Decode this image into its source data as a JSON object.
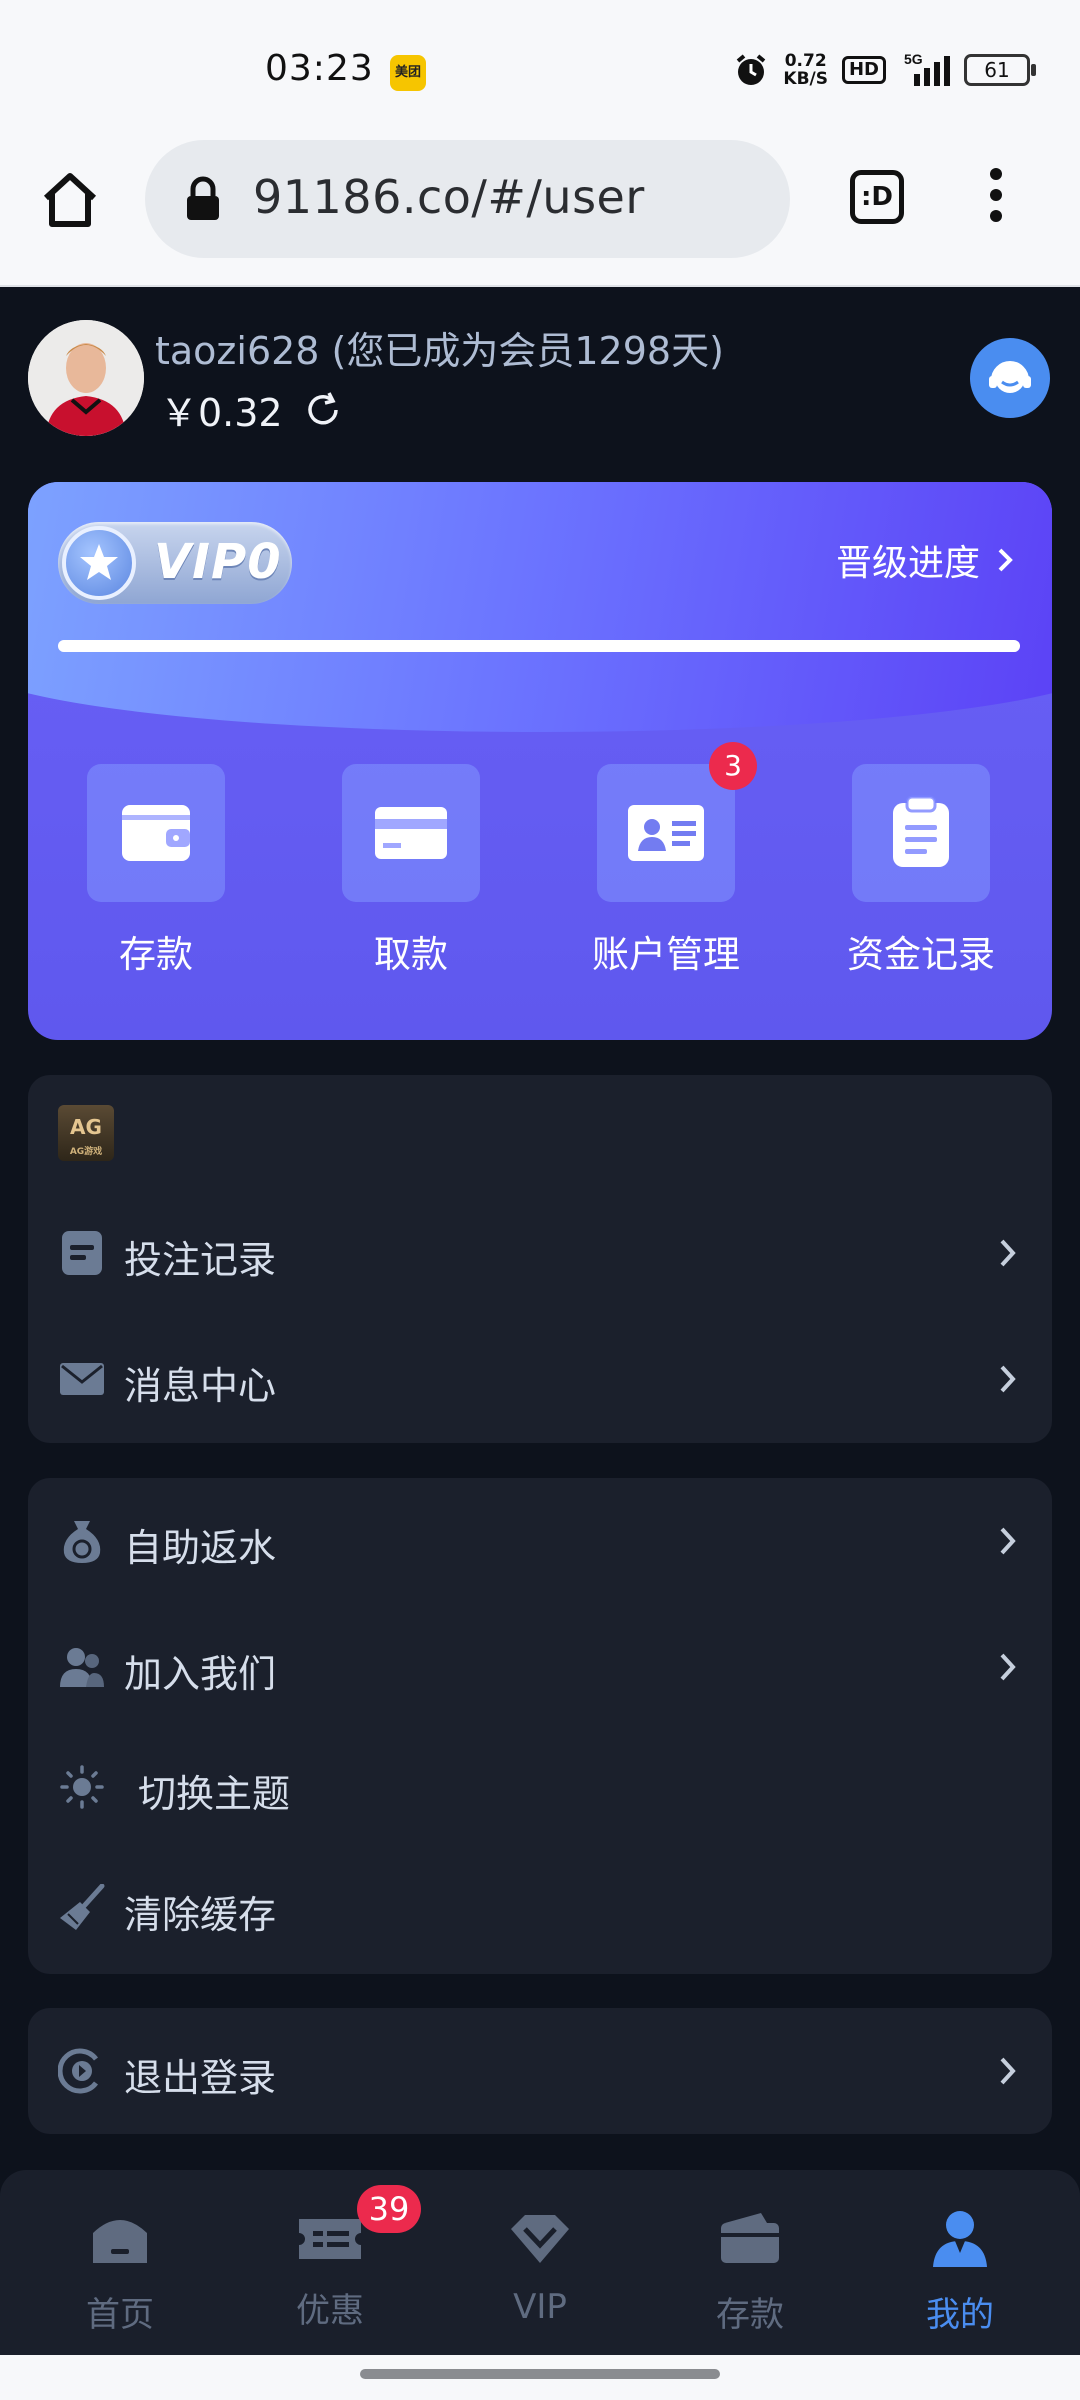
{
  "status_bar": {
    "time": "03:23",
    "app_badge": "美团",
    "net_speed_value": "0.72",
    "net_speed_unit": "KB/S",
    "hd": "HD",
    "network": "5G",
    "battery": "61"
  },
  "browser": {
    "url": "91186.co/#/user",
    "tabs_label": ":D"
  },
  "user": {
    "name": "taozi628 (您已成为会员1298天)",
    "balance": "￥0.32"
  },
  "vip": {
    "level": "VIP0",
    "progress_label": "晋级进度",
    "progress_fraction": 1.0,
    "actions": [
      {
        "label": "存款",
        "icon": "wallet-icon"
      },
      {
        "label": "取款",
        "icon": "card-icon"
      },
      {
        "label": "账户管理",
        "icon": "id-card-icon",
        "badge": "3"
      },
      {
        "label": "资金记录",
        "icon": "clipboard-icon"
      }
    ]
  },
  "panel1": {
    "logo_text": "AG",
    "logo_caption": "AG游戏",
    "items": [
      {
        "label": "投注记录",
        "icon": "bet-record-icon"
      },
      {
        "label": "消息中心",
        "icon": "mail-icon"
      }
    ]
  },
  "panel2": {
    "items": [
      {
        "label": "自助返水",
        "icon": "money-bag-icon"
      },
      {
        "label": "加入我们",
        "icon": "users-icon"
      },
      {
        "label": "切换主题",
        "icon": "sun-icon"
      },
      {
        "label": "清除缓存",
        "icon": "broom-icon"
      }
    ]
  },
  "panel3": {
    "items": [
      {
        "label": "退出登录",
        "icon": "logout-icon"
      }
    ]
  },
  "bottom_nav": [
    {
      "label": "首页",
      "icon": "home-icon"
    },
    {
      "label": "优惠",
      "icon": "ticket-icon",
      "badge": "39"
    },
    {
      "label": "VIP",
      "icon": "diamond-icon"
    },
    {
      "label": "存款",
      "icon": "wallet-icon"
    },
    {
      "label": "我的",
      "icon": "user-icon",
      "active": true
    }
  ],
  "colors": {
    "background": "#0d121c",
    "panel": "#1b202c",
    "accent": "#4a8df0",
    "vip_card": "#6a61f7",
    "badge": "#ec2a4d"
  }
}
